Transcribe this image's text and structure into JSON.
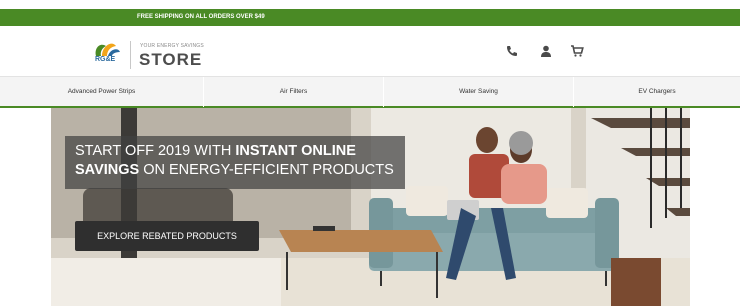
{
  "promo": {
    "text": "FREE SHIPPING ON ALL ORDERS OVER $49"
  },
  "brand": {
    "logo_text": "RG&E",
    "tagline_line1": "YOUR ENERGY SAVINGS",
    "tagline_line2": "STORE"
  },
  "header_icons": [
    "phone-icon",
    "user-icon",
    "cart-icon"
  ],
  "nav": {
    "items": [
      {
        "label": "Advanced Power Strips"
      },
      {
        "label": "Air Filters"
      },
      {
        "label": "Water Saving"
      },
      {
        "label": "EV Chargers"
      }
    ]
  },
  "hero": {
    "headline_part1": "START OFF 2019 WITH ",
    "headline_bold1": "INSTANT ONLINE SAVINGS",
    "headline_part2": " ON ENERGY-EFFICIENT PRODUCTS",
    "cta_label": "EXPLORE REBATED PRODUCTS"
  },
  "colors": {
    "brand_green": "#4a8a25",
    "dark_text": "#4d4d4d",
    "cta_bg": "#2f2f2f"
  }
}
